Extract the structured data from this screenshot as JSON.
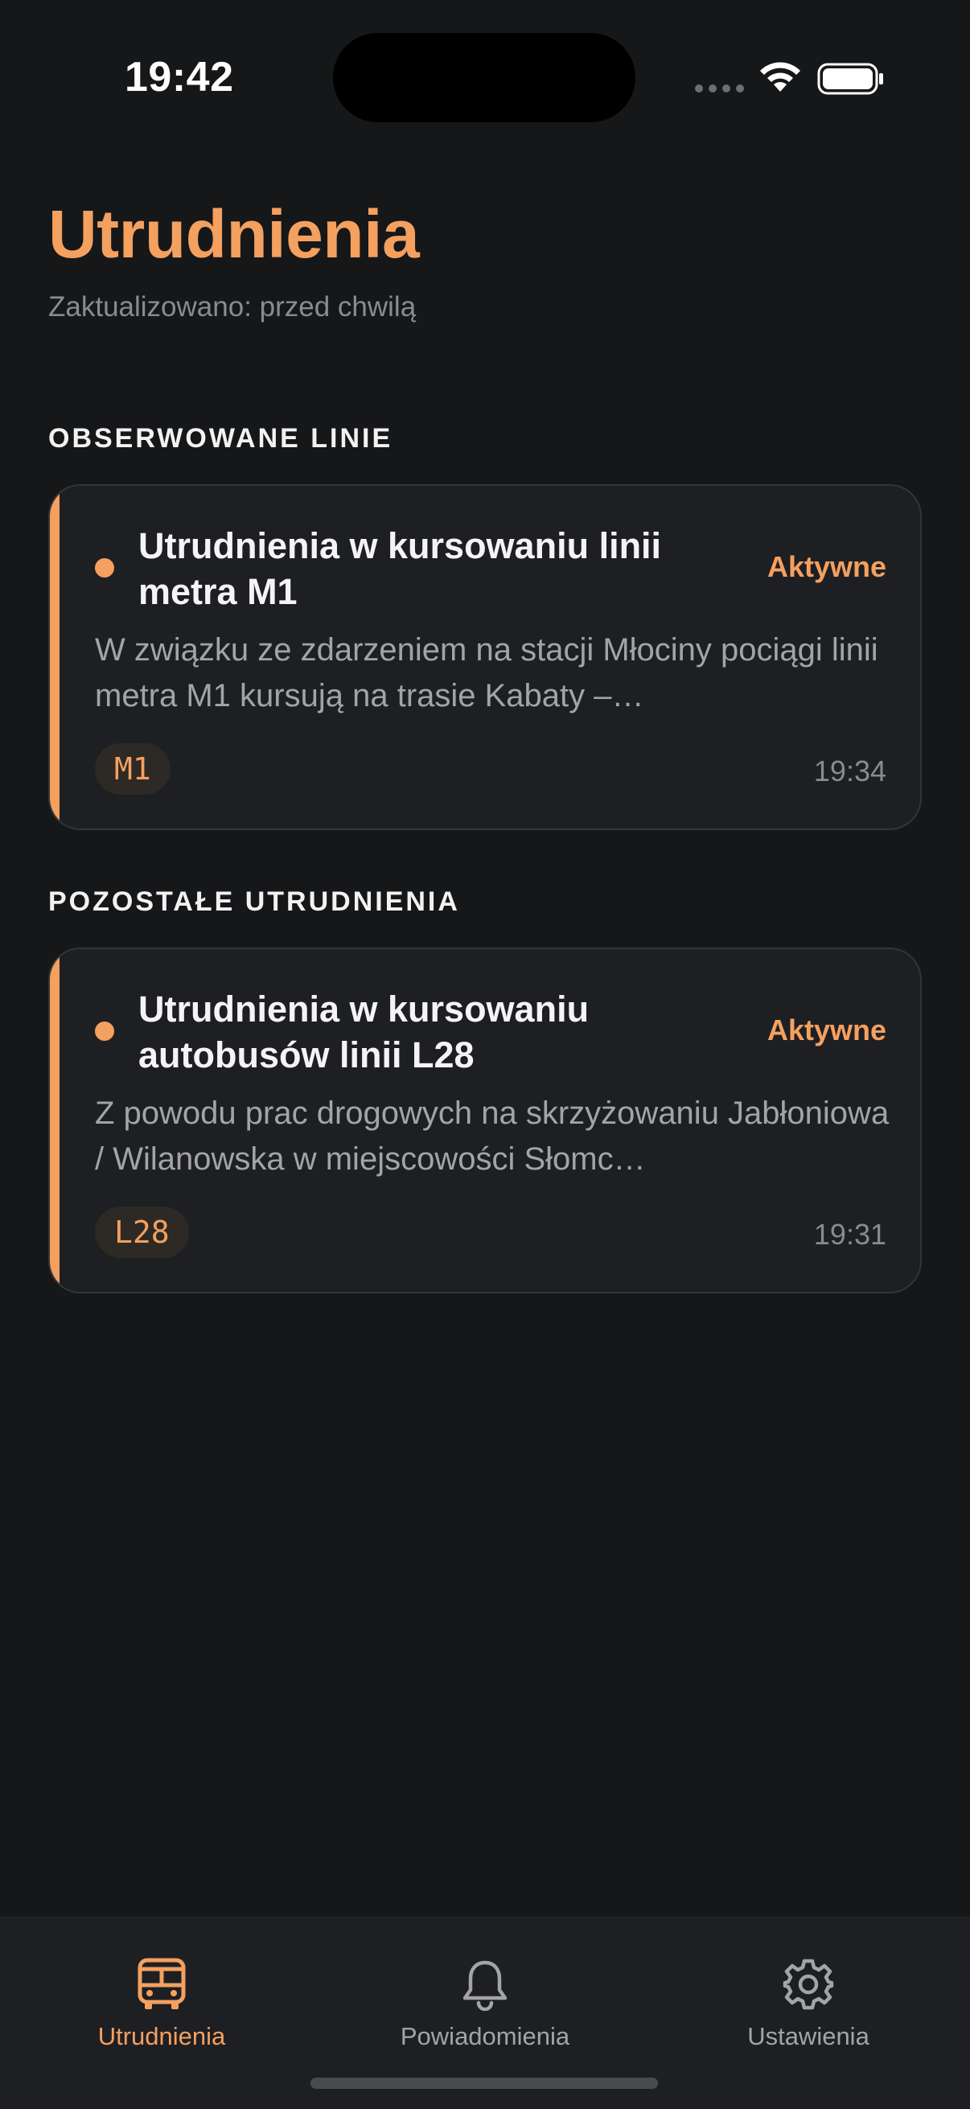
{
  "status_bar": {
    "time": "19:42"
  },
  "header": {
    "title": "Utrudnienia",
    "updated": "Zaktualizowano: przed chwilą"
  },
  "sections": [
    {
      "label": "OBSERWOWANE LINIE",
      "cards": [
        {
          "title": "Utrudnienia w kursowaniu linii metra M1",
          "status": "Aktywne",
          "description": "W związku ze zdarzeniem na stacji Młociny pociągi linii metra M1 kursują na trasie Kabaty –…",
          "line": "M1",
          "time": "19:34"
        }
      ]
    },
    {
      "label": "POZOSTAŁE UTRUDNIENIA",
      "cards": [
        {
          "title": "Utrudnienia w kursowaniu autobusów linii L28",
          "status": "Aktywne",
          "description": "Z powodu prac drogowych na skrzyżowaniu Jabłoniowa / Wilanowska w miejscowości Słomc…",
          "line": "L28",
          "time": "19:31"
        }
      ]
    }
  ],
  "tabbar": {
    "tabs": [
      {
        "label": "Utrudnienia",
        "icon": "bus-icon",
        "active": true
      },
      {
        "label": "Powiadomienia",
        "icon": "bell-icon",
        "active": false
      },
      {
        "label": "Ustawienia",
        "icon": "gear-icon",
        "active": false
      }
    ]
  },
  "colors": {
    "accent": "#f4a05f",
    "background": "#161719",
    "card": "#1e1f23"
  }
}
